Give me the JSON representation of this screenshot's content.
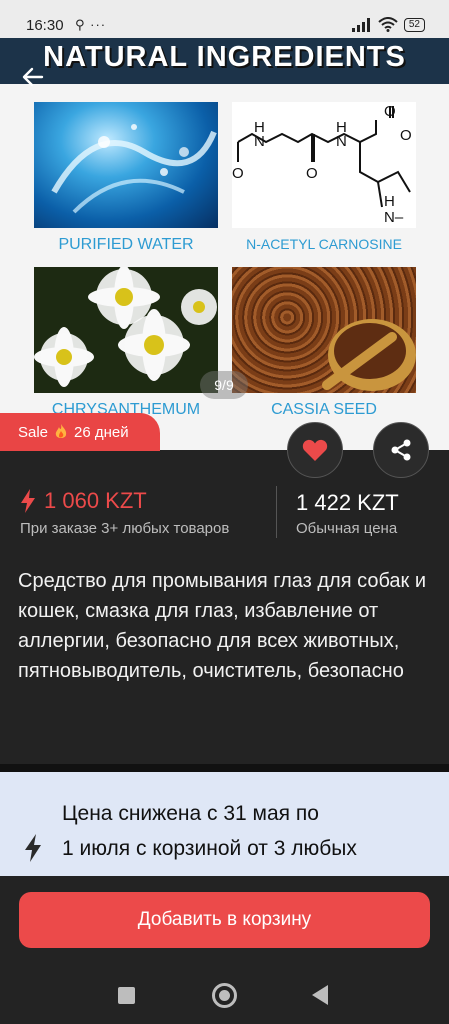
{
  "status_bar": {
    "time": "16:30",
    "left_icons": "⚲ ···",
    "battery": "52"
  },
  "gallery": {
    "banner_title": "NATURAL INGREDIENTS",
    "items": [
      {
        "label": "PURIFIED WATER"
      },
      {
        "label": "N-ACETYL CARNOSINE"
      },
      {
        "label": "CHRYSANTHEMUM"
      },
      {
        "label": "CASSIA SEED"
      }
    ],
    "page_indicator": "9/9"
  },
  "sale_badge": {
    "label": "Sale",
    "icon": "fire-icon",
    "days": "26 дней"
  },
  "prices": {
    "sale_price": "1 060 KZT",
    "sale_note": "При заказе 3+ любых товаров",
    "regular_price": "1 422 KZT",
    "regular_note": "Обычная цена"
  },
  "description": "Средство для промывания глаз для собак и кошек, смазка для глаз, избавление от аллергии, безопасно для всех животных, пятновыводитель, очиститель, безопасно",
  "promo": {
    "line1": "Цена снижена с 31 мая по",
    "line2": "1 июля с корзиной от 3 любых"
  },
  "cart_button": "Добавить в корзину",
  "colors": {
    "accent": "#ec4a4a",
    "background": "#232323",
    "promo_bg": "#dfe7f6",
    "label_blue": "#2d9bd2"
  }
}
